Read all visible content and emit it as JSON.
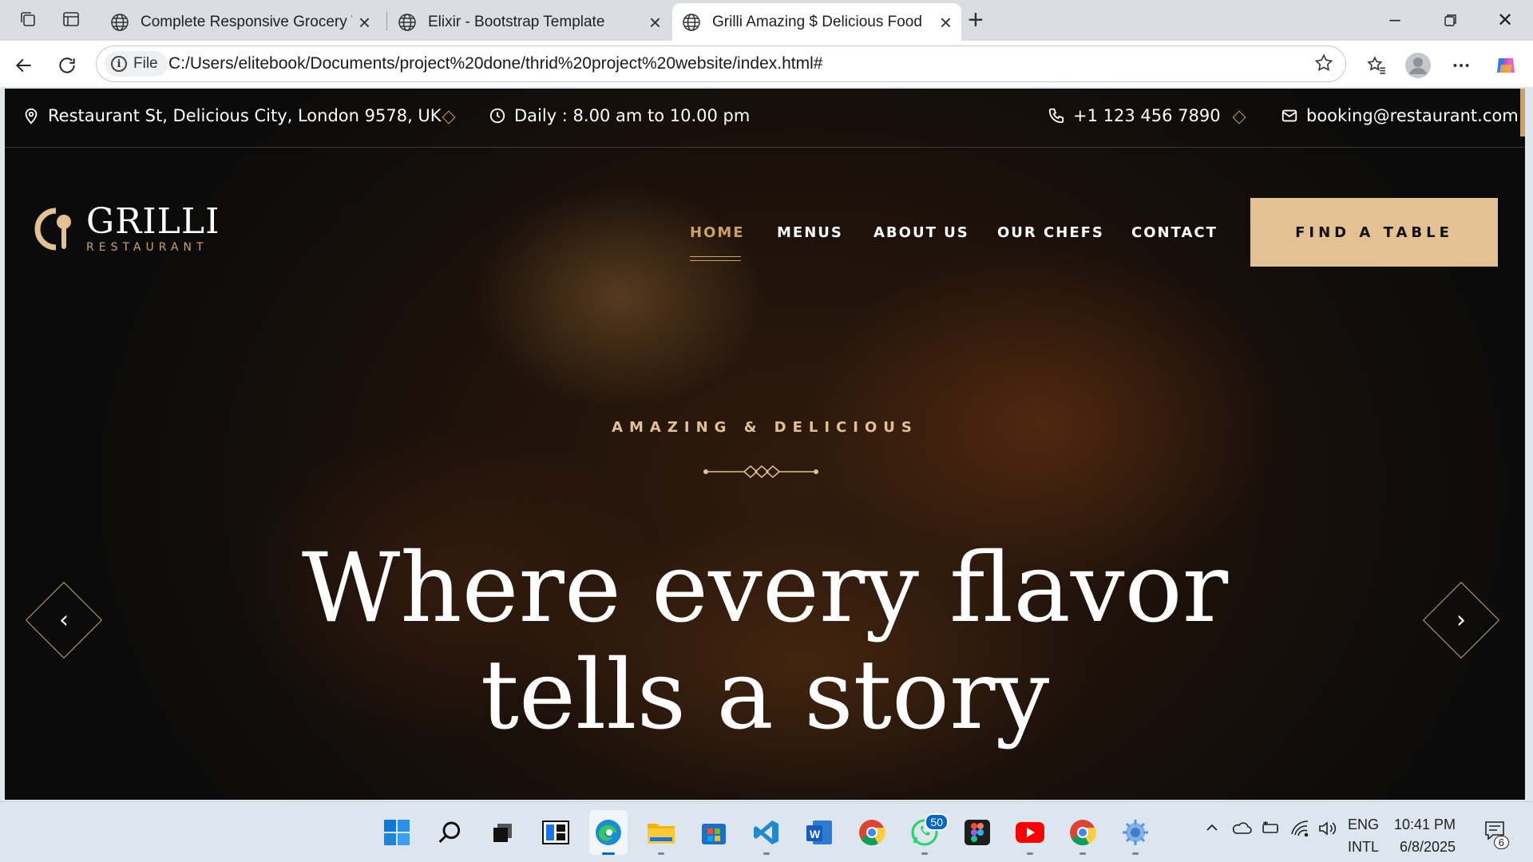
{
  "browser": {
    "tabs": [
      {
        "title": "Complete Responsive Grocery We",
        "active": false
      },
      {
        "title": "Elixir - Bootstrap Template",
        "active": false
      },
      {
        "title": "Grilli Amazing $ Delicious Food",
        "active": true
      }
    ],
    "file_label": "File",
    "url": "C:/Users/elitebook/Documents/project%20done/thrid%20project%20website/index.html#"
  },
  "site": {
    "topbar": {
      "address": "Restaurant St, Delicious City, London 9578, UK",
      "hours": "Daily : 8.00 am to 10.00 pm",
      "phone": "+1 123 456 7890",
      "email": "booking@restaurant.com"
    },
    "logo": {
      "name": "GRILLI",
      "subtitle": "RESTAURANT"
    },
    "nav": [
      "HOME",
      "MENUS",
      "ABOUT US",
      "OUR CHEFS",
      "CONTACT"
    ],
    "cta": "FIND A TABLE",
    "hero": {
      "kicker": "AMAZING & DELICIOUS",
      "headline_line1": "Where every flavor",
      "headline_line2": "tells a story"
    },
    "accent_color": "#c9a26a"
  },
  "taskbar": {
    "whatsapp_badge": "50",
    "language_line1": "ENG",
    "language_line2": "INTL",
    "time": "10:41 PM",
    "date": "6/8/2025",
    "notifications": "6"
  }
}
